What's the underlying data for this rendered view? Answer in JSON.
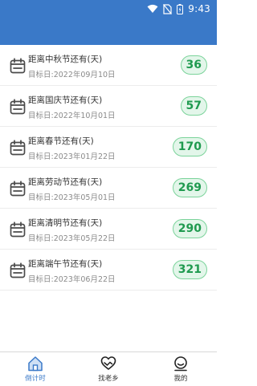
{
  "status_bar": {
    "time": "9:43",
    "icons": [
      "wifi-icon",
      "no-sim-icon",
      "battery-icon"
    ]
  },
  "countdowns": [
    {
      "title": "距离中秋节还有(天)",
      "target": "目标日:2022年09月10日",
      "days": "36"
    },
    {
      "title": "距离国庆节还有(天)",
      "target": "目标日:2022年10月01日",
      "days": "57"
    },
    {
      "title": "距离春节还有(天)",
      "target": "目标日:2023年01月22日",
      "days": "170"
    },
    {
      "title": "距离劳动节还有(天)",
      "target": "目标日:2023年05月01日",
      "days": "269"
    },
    {
      "title": "距离清明节还有(天)",
      "target": "目标日:2023年05月22日",
      "days": "290"
    },
    {
      "title": "距离端午节还有(天)",
      "target": "目标日:2023年06月22日",
      "days": "321"
    }
  ],
  "tabs": [
    {
      "label": "倒计时",
      "icon": "home-icon",
      "active": true
    },
    {
      "label": "找老乡",
      "icon": "heart-hands-icon",
      "active": false
    },
    {
      "label": "我的",
      "icon": "profile-icon",
      "active": false
    }
  ],
  "colors": {
    "header": "#3a79c8",
    "badge_border": "#7bd39a",
    "badge_fill": "#e3f6ea",
    "badge_text": "#1f9a4f",
    "active_tab": "#3a79c8"
  }
}
